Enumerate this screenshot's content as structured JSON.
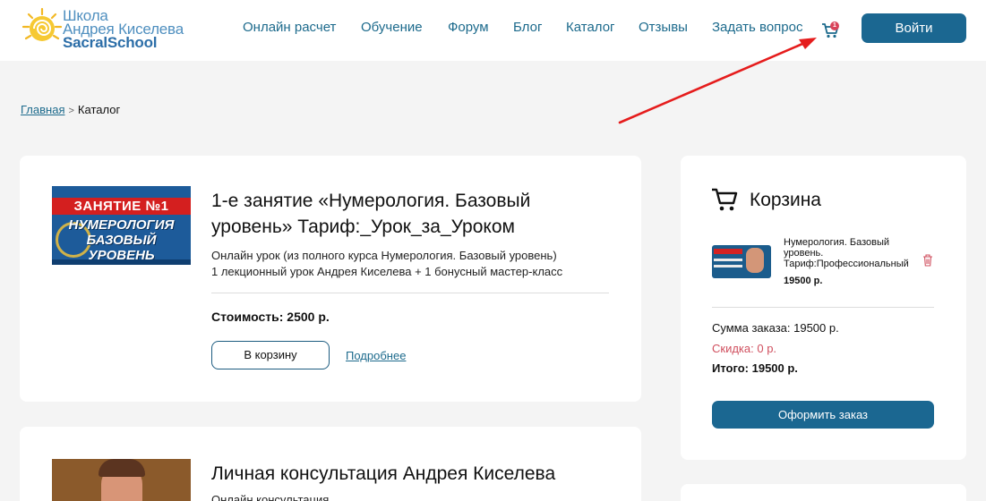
{
  "header": {
    "logo": {
      "line1": "Школа",
      "line2": "Андрея Киселева",
      "line3": "SacralSchool"
    },
    "nav": [
      {
        "label": "Онлайн расчет"
      },
      {
        "label": "Обучение"
      },
      {
        "label": "Форум"
      },
      {
        "label": "Блог"
      },
      {
        "label": "Каталог"
      },
      {
        "label": "Отзывы"
      },
      {
        "label": "Задать вопрос"
      }
    ],
    "cart_count": "1",
    "login_label": "Войти"
  },
  "breadcrumb": {
    "home": "Главная",
    "current": "Каталог"
  },
  "products": [
    {
      "thumb_line1": "ЗАНЯТИЕ №1",
      "thumb_line2": "НУМЕРОЛОГИЯ",
      "thumb_line3": "БАЗОВЫЙ",
      "thumb_line4": "УРОВЕНЬ",
      "title": "1-е занятие «Нумерология. Базовый уровень» Тариф:_Урок_за_Уроком",
      "desc_line1": "Онлайн урок (из полного курса Нумерология. Базовый уровень)",
      "desc_line2": "1 лекционный урок Андрея Киселева + 1 бонусный мастер-класс",
      "price": "Стоимость: 2500 р.",
      "cart_button": "В корзину",
      "more_link": "Подробнее"
    },
    {
      "title": "Личная консультация Андрея Киселева",
      "desc": "Онлайн консультация"
    }
  ],
  "cart": {
    "title": "Корзина",
    "item": {
      "title": "Нумерология. Базовый уровень. Тариф:Профессиональный",
      "price": "19500 р."
    },
    "sum": "Сумма заказа: 19500 р.",
    "discount": "Скидка: 0 р.",
    "total": "Итого: 19500 р.",
    "order_button": "Оформить заказ"
  },
  "colors": {
    "brand_blue": "#1b6791",
    "link": "#1c6a8c",
    "discount_red": "#d0505f",
    "badge": "#d9435a",
    "annotation_arrow": "#e51c1c"
  },
  "icons": [
    "sun-logo-icon",
    "cart-icon",
    "trash-icon",
    "breadcrumb-chevron-icon"
  ]
}
